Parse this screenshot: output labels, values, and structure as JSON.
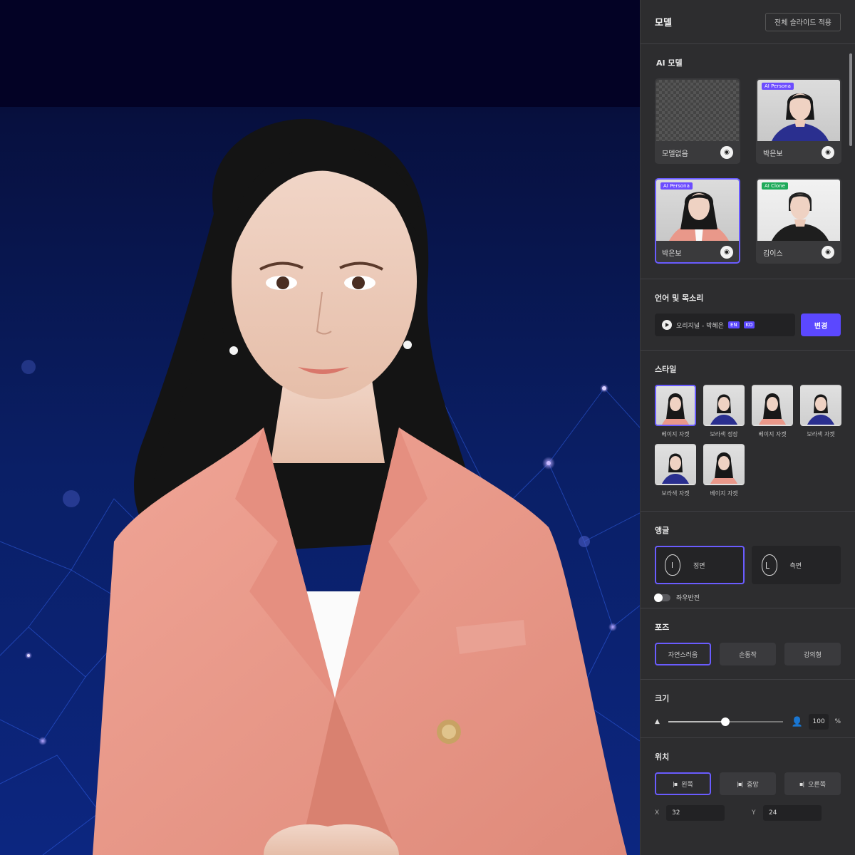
{
  "panel": {
    "title": "모델",
    "header_button": "전체 슬라이드 적용"
  },
  "models": {
    "section_title": "AI 모델",
    "items": [
      {
        "name": "모델없음",
        "tag": ""
      },
      {
        "name": "박은보",
        "tag": "AI Persona"
      },
      {
        "name": "박은보",
        "tag": "AI Persona"
      },
      {
        "name": "김이스",
        "tag": "AI Clone"
      }
    ]
  },
  "voice": {
    "section_title": "언어 및 목소리",
    "voice_label": "오리지널 - 박혜은",
    "lang_badges": [
      "EN",
      "KO"
    ],
    "change_button": "변경"
  },
  "styles": {
    "section_title": "스타일",
    "items": [
      {
        "label": "베이지 자켓"
      },
      {
        "label": "보라색 정장"
      },
      {
        "label": "베이지 자켓"
      },
      {
        "label": "보라색 자켓"
      },
      {
        "label": "보라색 자켓"
      },
      {
        "label": "베이지 자켓"
      }
    ]
  },
  "angle": {
    "section_title": "앵글",
    "options": [
      "정면",
      "측면"
    ],
    "toggle_label": "좌우반전"
  },
  "pose": {
    "section_title": "포즈",
    "options": [
      "자연스러움",
      "손동작",
      "강의형"
    ]
  },
  "size": {
    "section_title": "크기",
    "value": "100",
    "unit": "%"
  },
  "position": {
    "section_title": "위치",
    "options": [
      "왼쪽",
      "중앙",
      "오른쪽"
    ],
    "x_label": "X",
    "x_value": "32",
    "y_label": "Y",
    "y_value": "24"
  },
  "colors": {
    "accent": "#5b48ff",
    "selected_border": "#6a5cff",
    "panel_bg": "#2d2d2f",
    "canvas_bg": "#0a1f66",
    "blazer": "#e9988a"
  }
}
